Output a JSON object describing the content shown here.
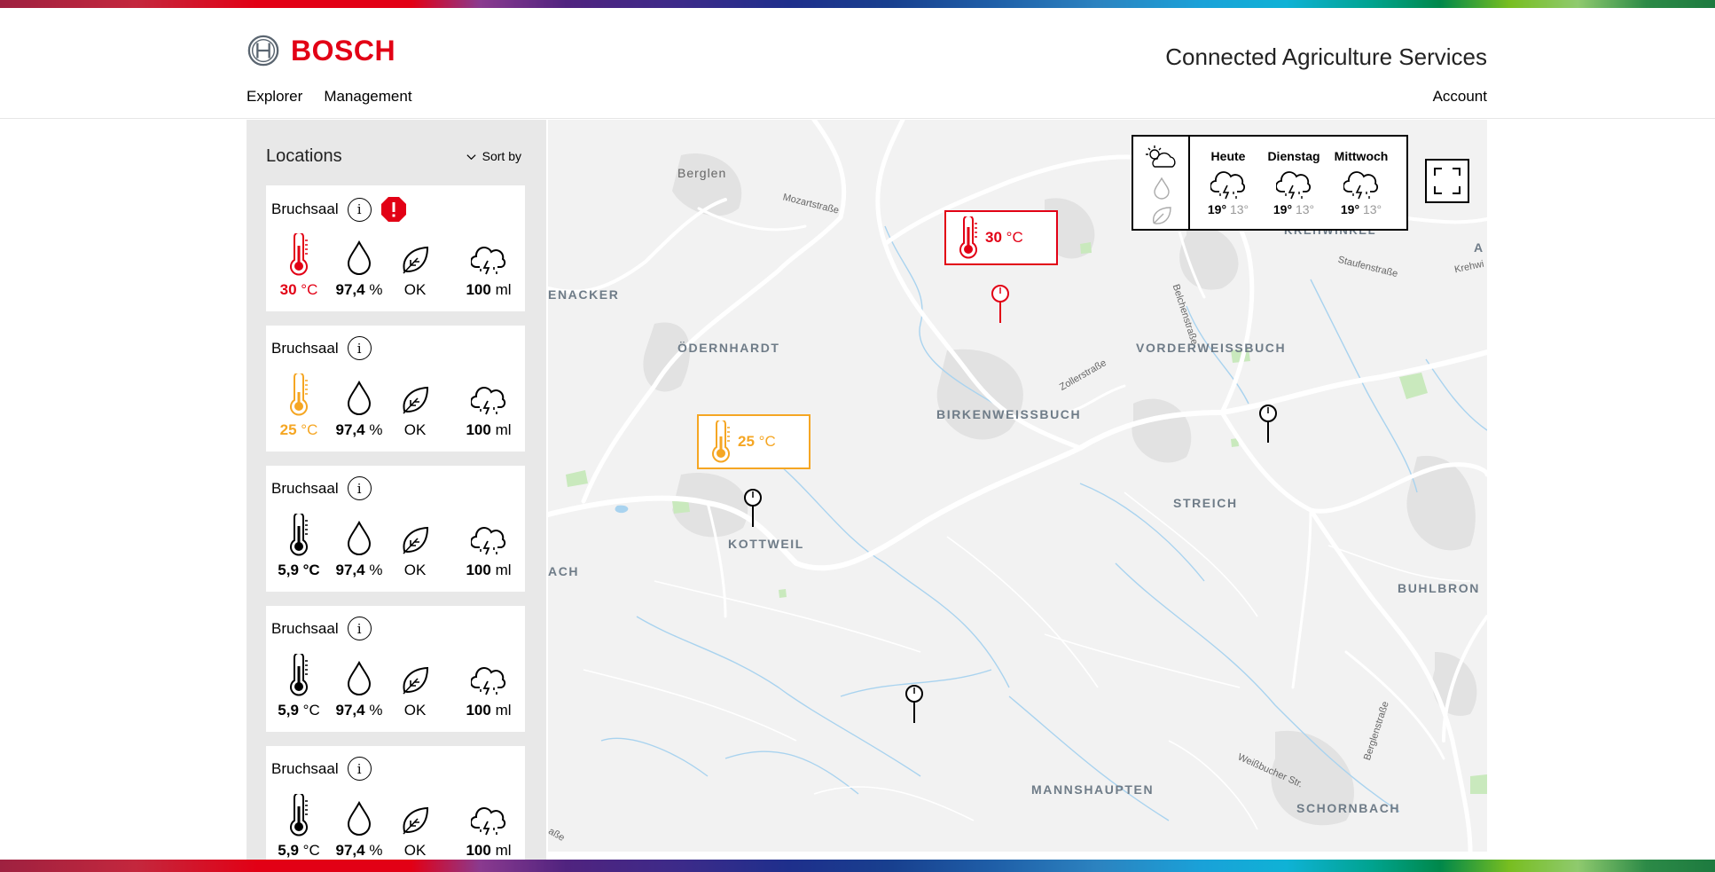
{
  "brand": {
    "name": "BOSCH",
    "app_title": "Connected Agriculture Services",
    "accent": "#e20015"
  },
  "nav": {
    "items": [
      "Explorer",
      "Management"
    ],
    "account": "Account"
  },
  "sidebar": {
    "title": "Locations",
    "sort_label": "Sort by",
    "cards": [
      {
        "name": "Bruchsaal",
        "alert": true,
        "status": "red",
        "temp": "30",
        "temp_unit": "°C",
        "humidity": "97,4",
        "humidity_unit": "%",
        "leaf": "OK",
        "rain": "100",
        "rain_unit": "ml"
      },
      {
        "name": "Bruchsaal",
        "alert": false,
        "status": "amber",
        "temp": "25",
        "temp_unit": "°C",
        "humidity": "97,4",
        "humidity_unit": "%",
        "leaf": "OK",
        "rain": "100",
        "rain_unit": "ml"
      },
      {
        "name": "Bruchsaal",
        "alert": false,
        "status": "normal",
        "temp": "5,9 °C",
        "temp_unit": "",
        "humidity": "97,4",
        "humidity_unit": "%",
        "leaf": "OK",
        "rain": "100",
        "rain_unit": "ml"
      },
      {
        "name": "Bruchsaal",
        "alert": false,
        "status": "normal",
        "temp": "5,9",
        "temp_unit": "°C",
        "humidity": "97,4",
        "humidity_unit": "%",
        "leaf": "OK",
        "rain": "100",
        "rain_unit": "ml"
      },
      {
        "name": "Bruchsaal",
        "alert": false,
        "status": "normal",
        "temp": "5,9",
        "temp_unit": "°C",
        "humidity": "97,4",
        "humidity_unit": "%",
        "leaf": "OK",
        "rain": "100",
        "rain_unit": "ml"
      }
    ]
  },
  "map": {
    "labels": {
      "berglen": "Berglen",
      "odernhardt": "ÖDERNHARDT",
      "enacker": "ENACKER",
      "birkenweissbuch": "BIRKENWEISSBUCH",
      "vorderweissbuch": "VORDERWEISSBUCH",
      "kottweil": "KOTTWEIL",
      "streich": "STREICH",
      "buhlbronn": "BUHLBRON",
      "mannshaupten": "MANNSHAUPTEN",
      "schornbach": "SCHORNBACH",
      "ach": "ACH",
      "krehwinkel": "KREHWINKEL",
      "a": "A",
      "mozartstrasse": "Mozartstraße",
      "staufenstrasse": "Staufenstraße",
      "krehwi": "Krehwi",
      "zollerstrasse": "Zollerstraße",
      "belchenstrasse": "Belchenstraße",
      "weissbucher": "Weißbucher Str.",
      "berglenstrasse": "Berglenstraße",
      "sse": "aße"
    },
    "temp_markers": [
      {
        "value": "30",
        "unit": "°C",
        "status": "red"
      },
      {
        "value": "25",
        "unit": "°C",
        "status": "amber"
      }
    ]
  },
  "weather": {
    "days": [
      {
        "name": "Heute",
        "high": "19°",
        "low": "13°",
        "icon": "thunderstorm-icon"
      },
      {
        "name": "Dienstag",
        "high": "19°",
        "low": "13°",
        "icon": "thunderstorm-icon"
      },
      {
        "name": "Mittwoch",
        "high": "19°",
        "low": "13°",
        "icon": "thunderstorm-icon"
      }
    ]
  }
}
